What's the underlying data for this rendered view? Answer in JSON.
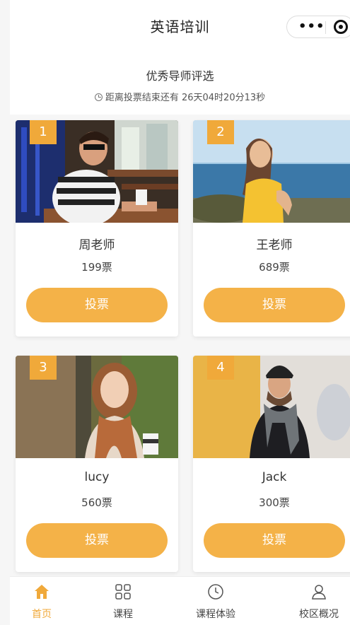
{
  "navbar": {
    "title": "英语培训",
    "menu_icon": "more-dots-icon",
    "close_icon": "target-circle-icon"
  },
  "header": {
    "title": "优秀导师评选",
    "countdown": "距离投票结束还有 26天04时20分13秒",
    "clock_icon": "clock-icon"
  },
  "teachers": [
    {
      "rank": "1",
      "name": "周老师",
      "votes": "199票",
      "button": "投票"
    },
    {
      "rank": "2",
      "name": "王老师",
      "votes": "689票",
      "button": "投票"
    },
    {
      "rank": "3",
      "name": "lucy",
      "votes": "560票",
      "button": "投票"
    },
    {
      "rank": "4",
      "name": "Jack",
      "votes": "300票",
      "button": "投票"
    }
  ],
  "tabbar": {
    "items": [
      {
        "label": "首页",
        "icon": "home-icon",
        "active": true
      },
      {
        "label": "课程",
        "icon": "grid-icon",
        "active": false
      },
      {
        "label": "课程体验",
        "icon": "clock-icon",
        "active": false
      },
      {
        "label": "校区概况",
        "icon": "user-icon",
        "active": false
      }
    ]
  },
  "colors": {
    "accent": "#f0a93a",
    "button": "#f4b248"
  }
}
